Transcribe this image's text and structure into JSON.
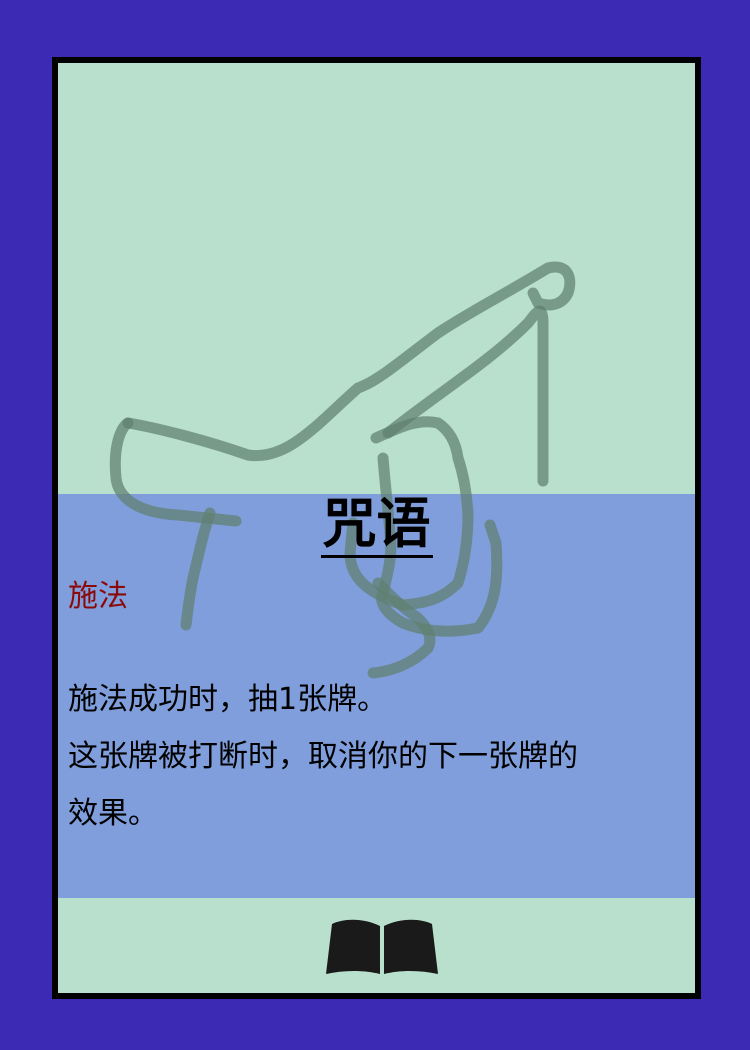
{
  "card": {
    "title": "咒语",
    "type_label": "施法",
    "description_lines": [
      "施法成功时，抽1张牌。",
      "这张牌被打断时，取消你的下一张牌的",
      "效果。"
    ],
    "art_icon": "hand-drawn-outline-icon",
    "footer_icon": "book-icon"
  },
  "colors": {
    "background": "#3c2ab4",
    "card_top": "#b8e0cc",
    "card_text_panel": "#7f9edb",
    "border": "#000000",
    "type_label": "#8a0a0a",
    "art_stroke": "#6e8a7e"
  }
}
